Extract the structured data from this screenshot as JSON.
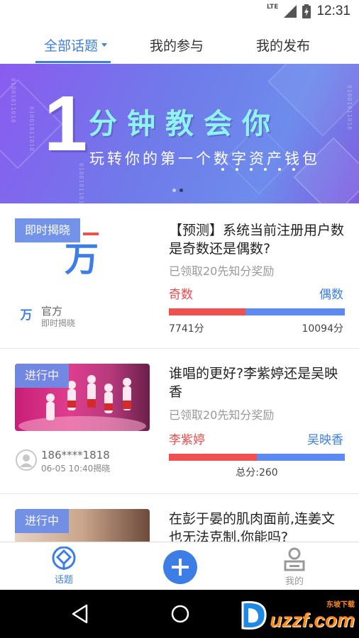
{
  "status_bar": {
    "network": "LTE",
    "time": "12:31"
  },
  "tabs": [
    {
      "label": "全部话题",
      "active": true
    },
    {
      "label": "我的参与",
      "active": false
    },
    {
      "label": "我的发布",
      "active": false
    }
  ],
  "banner": {
    "big_number": "1",
    "title": "分钟教会你",
    "subtitle": "玩转你的第一个数字资产钱包",
    "binary_text": "01001011010",
    "page_index": 2,
    "page_count": 2
  },
  "cards": [
    {
      "badge": "即时揭晓",
      "thumb_glyph": "万",
      "title": "【预测】系统当前注册用户数是奇数还是偶数?",
      "reward": "已领取20先知分奖励",
      "option_left": "奇数",
      "option_right": "偶数",
      "score_left": "7741分",
      "score_right": "10094分",
      "left_share": 0.434,
      "author_icon": "wan-logo-icon",
      "author_glyph": "万",
      "author_name": "官方",
      "author_meta": "即时揭晓"
    },
    {
      "badge": "进行中",
      "title": "谁唱的更好?李紫婷还是吴映香",
      "reward": "已领取20先知分奖励",
      "option_left": "李紫婷",
      "option_right": "吴映香",
      "score_total": "总分:260",
      "left_share": 0.5,
      "author_icon": "avatar-placeholder-icon",
      "author_name": "186****1818",
      "author_meta": "06-05 10:40揭晓"
    },
    {
      "badge": "进行中",
      "title": "在彭于晏的肌肉面前,连姜文也无法克制,你能吗?"
    }
  ],
  "bottom_nav": {
    "topics_label": "话题",
    "mine_label": "我的",
    "accent": "#3d7ee6"
  },
  "watermark": {
    "text": "uzzf.com",
    "tagline": "东坡下载"
  },
  "colors": {
    "accent": "#3d7ee6",
    "red": "#f05050",
    "blue": "#5b8bf2"
  }
}
